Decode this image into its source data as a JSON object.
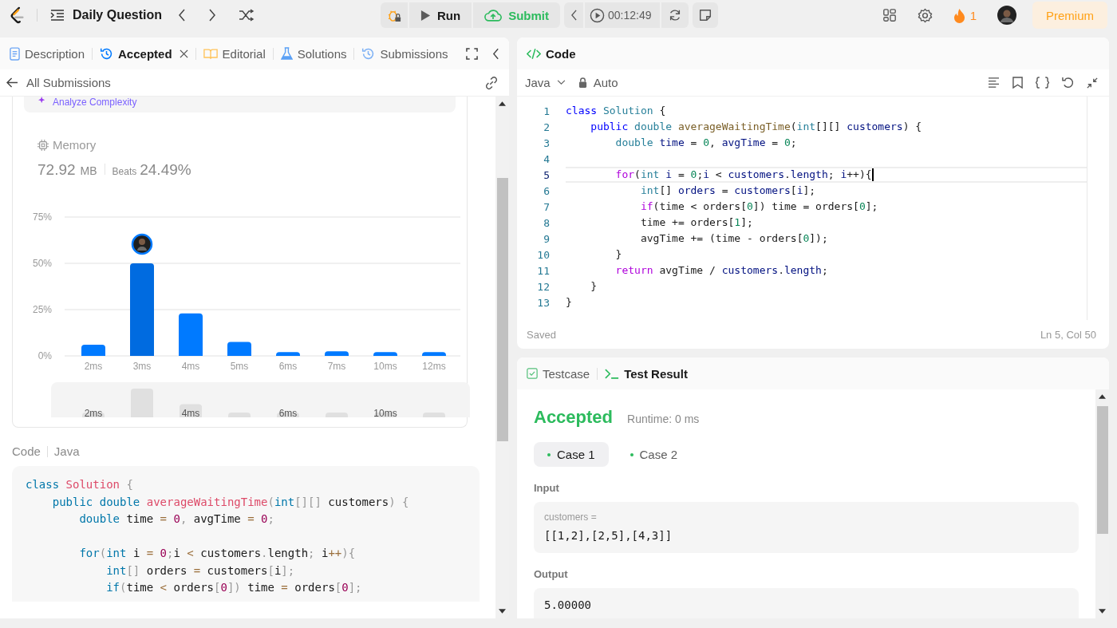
{
  "top_bar": {
    "title": "Daily Question",
    "run": "Run",
    "submit": "Submit",
    "timer": "00:12:49",
    "streak": "1",
    "premium": "Premium"
  },
  "left_panel": {
    "tabs": [
      {
        "label": "Description",
        "kind": "description",
        "selected": false,
        "closable": false
      },
      {
        "label": "Accepted",
        "kind": "accepted",
        "selected": true,
        "closable": true
      },
      {
        "label": "Editorial",
        "kind": "editorial",
        "selected": false,
        "closable": false
      },
      {
        "label": "Solutions",
        "kind": "solutions",
        "selected": false,
        "closable": false
      },
      {
        "label": "Submissions",
        "kind": "submissions",
        "selected": false,
        "closable": false
      }
    ],
    "back_link": "All Submissions",
    "analyze": "Analyze Complexity",
    "memory": {
      "title": "Memory",
      "value": "72.92",
      "unit": "MB",
      "beats_label": "Beats",
      "beats": "24.49%"
    },
    "chart_data": {
      "type": "bar",
      "categories": [
        "2ms",
        "3ms",
        "4ms",
        "5ms",
        "6ms",
        "7ms",
        "10ms",
        "12ms"
      ],
      "series": [
        {
          "color": "#007aff",
          "values": [
            6,
            50,
            23,
            7.5,
            2,
            2.5,
            2,
            2
          ]
        }
      ],
      "ylim": [
        0,
        75
      ],
      "yticks": [
        {
          "value": 0,
          "label": "0%"
        },
        {
          "value": 25,
          "label": "25%"
        },
        {
          "value": 50,
          "label": "50%"
        },
        {
          "value": 75,
          "label": "75%"
        }
      ],
      "annotations": [
        {
          "x": "3ms"
        }
      ]
    },
    "overview_labels": [
      "2ms",
      "4ms",
      "6ms",
      "10ms"
    ],
    "code_header": {
      "label": "Code",
      "language": "Java"
    },
    "code_lines": [
      {
        "kind": "code",
        "tokens": [
          {
            "text": "class ",
            "kind": "keyword"
          },
          {
            "text": "Solution ",
            "kind": "class"
          },
          {
            "text": "{",
            "kind": "punctuation"
          }
        ]
      },
      {
        "kind": "code",
        "tokens": [
          {
            "text": "    public ",
            "kind": "keyword"
          },
          {
            "text": "double ",
            "kind": "type"
          },
          {
            "text": "averageWaitingTime",
            "kind": "function"
          },
          {
            "text": "(",
            "kind": "punctuation"
          },
          {
            "text": "int",
            "kind": "type"
          },
          {
            "text": "[][] ",
            "kind": "punctuation"
          },
          {
            "text": "customers",
            "kind": "variable"
          },
          {
            "text": ") {",
            "kind": "punctuation"
          }
        ]
      },
      {
        "kind": "code",
        "tokens": [
          {
            "text": "        double ",
            "kind": "type"
          },
          {
            "text": "time",
            "kind": "variable"
          },
          {
            "text": " = ",
            "kind": "operator"
          },
          {
            "text": "0",
            "kind": "number"
          },
          {
            "text": ", ",
            "kind": "punctuation"
          },
          {
            "text": "avgTime",
            "kind": "variable"
          },
          {
            "text": " = ",
            "kind": "operator"
          },
          {
            "text": "0",
            "kind": "number"
          },
          {
            "text": ";",
            "kind": "punctuation"
          }
        ]
      },
      {
        "kind": "blank"
      },
      {
        "kind": "code",
        "tokens": [
          {
            "text": "        for",
            "kind": "control"
          },
          {
            "text": "(",
            "kind": "punctuation"
          },
          {
            "text": "int ",
            "kind": "type"
          },
          {
            "text": "i",
            "kind": "variable"
          },
          {
            "text": " = ",
            "kind": "operator"
          },
          {
            "text": "0",
            "kind": "number"
          },
          {
            "text": ";",
            "kind": "punctuation"
          },
          {
            "text": "i",
            "kind": "variable"
          },
          {
            "text": " < ",
            "kind": "operator"
          },
          {
            "text": "customers",
            "kind": "variable"
          },
          {
            "text": ".",
            "kind": "punctuation"
          },
          {
            "text": "length",
            "kind": "variable"
          },
          {
            "text": "; ",
            "kind": "punctuation"
          },
          {
            "text": "i",
            "kind": "variable"
          },
          {
            "text": "++",
            "kind": "operator"
          },
          {
            "text": "){",
            "kind": "punctuation"
          }
        ]
      },
      {
        "kind": "code",
        "tokens": [
          {
            "text": "            int",
            "kind": "type"
          },
          {
            "text": "[] ",
            "kind": "punctuation"
          },
          {
            "text": "orders",
            "kind": "variable"
          },
          {
            "text": " = ",
            "kind": "operator"
          },
          {
            "text": "customers",
            "kind": "variable"
          },
          {
            "text": "[",
            "kind": "punctuation"
          },
          {
            "text": "i",
            "kind": "variable"
          },
          {
            "text": "];",
            "kind": "punctuation"
          }
        ]
      },
      {
        "kind": "code",
        "tokens": [
          {
            "text": "            if",
            "kind": "control"
          },
          {
            "text": "(",
            "kind": "punctuation"
          },
          {
            "text": "time",
            "kind": "variable"
          },
          {
            "text": " < ",
            "kind": "operator"
          },
          {
            "text": "orders",
            "kind": "variable"
          },
          {
            "text": "[",
            "kind": "punctuation"
          },
          {
            "text": "0",
            "kind": "number"
          },
          {
            "text": "]) ",
            "kind": "punctuation"
          },
          {
            "text": "time",
            "kind": "variable"
          },
          {
            "text": " = ",
            "kind": "operator"
          },
          {
            "text": "orders",
            "kind": "variable"
          },
          {
            "text": "[",
            "kind": "punctuation"
          },
          {
            "text": "0",
            "kind": "number"
          },
          {
            "text": "];",
            "kind": "punctuation"
          }
        ]
      }
    ]
  },
  "editor": {
    "title": "Code",
    "language": "Java",
    "mode": "Auto",
    "lines": [
      {
        "number": "1",
        "current": false,
        "tokens": [
          {
            "text": "class ",
            "kind": "keyword"
          },
          {
            "text": "Solution ",
            "kind": "class"
          },
          {
            "text": "{",
            "kind": "punctuation"
          }
        ]
      },
      {
        "number": "2",
        "current": false,
        "tokens": [
          {
            "text": "    public ",
            "kind": "keyword"
          },
          {
            "text": "double ",
            "kind": "type"
          },
          {
            "text": "averageWaitingTime",
            "kind": "function"
          },
          {
            "text": "(",
            "kind": "punctuation"
          },
          {
            "text": "int",
            "kind": "type"
          },
          {
            "text": "[][] ",
            "kind": "punctuation"
          },
          {
            "text": "customers",
            "kind": "variable"
          },
          {
            "text": ") {",
            "kind": "punctuation"
          }
        ]
      },
      {
        "number": "3",
        "current": false,
        "tokens": [
          {
            "text": "        double ",
            "kind": "type"
          },
          {
            "text": "time",
            "kind": "variable"
          },
          {
            "text": " = ",
            "kind": "operator"
          },
          {
            "text": "0",
            "kind": "number"
          },
          {
            "text": ", ",
            "kind": "punctuation"
          },
          {
            "text": "avgTime",
            "kind": "variable"
          },
          {
            "text": " = ",
            "kind": "operator"
          },
          {
            "text": "0",
            "kind": "number"
          },
          {
            "text": ";",
            "kind": "punctuation"
          }
        ]
      },
      {
        "number": "4",
        "current": false
      },
      {
        "number": "5",
        "current": true,
        "tokens": [
          {
            "text": "        for",
            "kind": "control"
          },
          {
            "text": "(",
            "kind": "punctuation"
          },
          {
            "text": "int ",
            "kind": "type"
          },
          {
            "text": "i",
            "kind": "variable"
          },
          {
            "text": " = ",
            "kind": "operator"
          },
          {
            "text": "0",
            "kind": "number"
          },
          {
            "text": ";",
            "kind": "punctuation"
          },
          {
            "text": "i",
            "kind": "variable"
          },
          {
            "text": " < ",
            "kind": "operator"
          },
          {
            "text": "customers",
            "kind": "variable"
          },
          {
            "text": ".",
            "kind": "punctuation"
          },
          {
            "text": "length",
            "kind": "variable"
          },
          {
            "text": "; ",
            "kind": "punctuation"
          },
          {
            "text": "i",
            "kind": "variable"
          },
          {
            "text": "++",
            "kind": "operator"
          },
          {
            "text": "){",
            "kind": "punctuation"
          }
        ]
      },
      {
        "number": "6",
        "current": false,
        "tokens": [
          {
            "text": "            int",
            "kind": "type"
          },
          {
            "text": "[] ",
            "kind": "punctuation"
          },
          {
            "text": "orders",
            "kind": "variable"
          },
          {
            "text": " = ",
            "kind": "operator"
          },
          {
            "text": "customers",
            "kind": "variable"
          },
          {
            "text": "[",
            "kind": "punctuation"
          },
          {
            "text": "i",
            "kind": "variable"
          },
          {
            "text": "];",
            "kind": "punctuation"
          }
        ]
      },
      {
        "number": "7",
        "current": false,
        "tokens": [
          {
            "text": "            if",
            "kind": "control"
          },
          {
            "text": "(",
            "kind": "punctuation"
          },
          {
            "text": "time",
            "kind": "plain"
          },
          {
            "text": " < ",
            "kind": "operator"
          },
          {
            "text": "orders",
            "kind": "plain"
          },
          {
            "text": "[",
            "kind": "punctuation"
          },
          {
            "text": "0",
            "kind": "number"
          },
          {
            "text": "]) ",
            "kind": "punctuation"
          },
          {
            "text": "time",
            "kind": "plain"
          },
          {
            "text": " = ",
            "kind": "operator"
          },
          {
            "text": "orders",
            "kind": "plain"
          },
          {
            "text": "[",
            "kind": "punctuation"
          },
          {
            "text": "0",
            "kind": "number"
          },
          {
            "text": "];",
            "kind": "punctuation"
          }
        ]
      },
      {
        "number": "8",
        "current": false,
        "tokens": [
          {
            "text": "            time",
            "kind": "plain"
          },
          {
            "text": " += ",
            "kind": "operator"
          },
          {
            "text": "orders",
            "kind": "plain"
          },
          {
            "text": "[",
            "kind": "punctuation"
          },
          {
            "text": "1",
            "kind": "number"
          },
          {
            "text": "];",
            "kind": "punctuation"
          }
        ]
      },
      {
        "number": "9",
        "current": false,
        "tokens": [
          {
            "text": "            avgTime",
            "kind": "plain"
          },
          {
            "text": " += ",
            "kind": "operator"
          },
          {
            "text": "(",
            "kind": "punctuation"
          },
          {
            "text": "time",
            "kind": "plain"
          },
          {
            "text": " - ",
            "kind": "operator"
          },
          {
            "text": "orders",
            "kind": "plain"
          },
          {
            "text": "[",
            "kind": "punctuation"
          },
          {
            "text": "0",
            "kind": "number"
          },
          {
            "text": "]);",
            "kind": "punctuation"
          }
        ]
      },
      {
        "number": "10",
        "current": false,
        "tokens": [
          {
            "text": "        }",
            "kind": "punctuation"
          }
        ]
      },
      {
        "number": "11",
        "current": false,
        "tokens": [
          {
            "text": "        return ",
            "kind": "control"
          },
          {
            "text": "avgTime",
            "kind": "plain"
          },
          {
            "text": " / ",
            "kind": "operator"
          },
          {
            "text": "customers",
            "kind": "variable"
          },
          {
            "text": ".",
            "kind": "punctuation"
          },
          {
            "text": "length",
            "kind": "variable"
          },
          {
            "text": ";",
            "kind": "punctuation"
          }
        ]
      },
      {
        "number": "12",
        "current": false,
        "tokens": [
          {
            "text": "    }",
            "kind": "punctuation"
          }
        ]
      },
      {
        "number": "13",
        "current": false,
        "tokens": [
          {
            "text": "}",
            "kind": "punctuation"
          }
        ]
      }
    ],
    "saved": "Saved",
    "position": "Ln 5, Col 50"
  },
  "result": {
    "tabs": [
      {
        "label": "Testcase",
        "kind": "testcase",
        "selected": false
      },
      {
        "label": "Test Result",
        "kind": "result",
        "selected": true
      }
    ],
    "verdict": "Accepted",
    "runtime": "Runtime: 0 ms",
    "cases": [
      {
        "label": "Case 1",
        "selected": true
      },
      {
        "label": "Case 2",
        "selected": false
      }
    ],
    "input_label": "Input",
    "inputs": [
      {
        "name": "customers =",
        "value": "[[1,2],[2,5],[4,3]]"
      }
    ],
    "output_label": "Output",
    "output": "5.00000"
  }
}
